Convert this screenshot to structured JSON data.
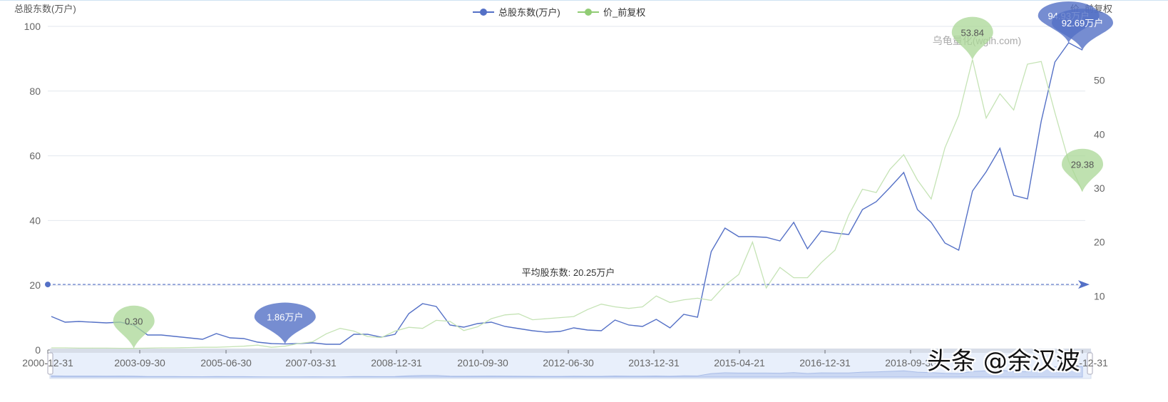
{
  "chart_data": {
    "type": "line",
    "legend": [
      "总股东数(万户)",
      "价_前复权"
    ],
    "legend_position": "top-center",
    "y_left": {
      "label": "总股东数(万户)",
      "range": [
        0,
        100
      ],
      "ticks": [
        "0",
        "20",
        "40",
        "60",
        "80",
        "100"
      ]
    },
    "y_right": {
      "label": "价_前复权",
      "range": [
        0,
        60
      ],
      "ticks": [
        "10",
        "20",
        "30",
        "40",
        "50"
      ]
    },
    "x_ticks": [
      "2000-12-31",
      "2003-09-30",
      "2005-06-30",
      "2007-03-31",
      "2008-12-31",
      "2010-09-30",
      "2012-06-30",
      "2013-12-31",
      "2015-04-21",
      "2016-12-31",
      "2018-09-30",
      "2021-12-31"
    ],
    "series": [
      {
        "name": "总股东数(万户)",
        "color": "#5470c6",
        "axis": "left",
        "values": [
          10.35,
          8.59,
          8.81,
          8.59,
          8.37,
          8.59,
          7.71,
          4.63,
          4.63,
          4.19,
          3.74,
          3.3,
          5.07,
          3.74,
          3.52,
          2.42,
          1.98,
          1.86,
          1.98,
          2.2,
          1.76,
          1.76,
          4.85,
          4.85,
          3.96,
          4.85,
          11.23,
          14.32,
          13.44,
          7.71,
          7.05,
          8.15,
          8.59,
          7.27,
          6.61,
          5.95,
          5.51,
          5.73,
          6.83,
          6.17,
          5.95,
          9.25,
          7.71,
          7.27,
          9.47,
          6.83,
          11.01,
          10.13,
          30.4,
          37.67,
          35.02,
          35.02,
          34.8,
          33.7,
          39.43,
          31.28,
          36.78,
          36.12,
          35.68,
          43.39,
          45.81,
          50.22,
          54.85,
          43.39,
          39.43,
          33.04,
          30.84,
          49.12,
          55.07,
          62.33,
          47.8,
          46.7,
          70.7,
          88.99,
          94.93,
          92.69
        ]
      },
      {
        "name": "价_前复权",
        "color": "#91cc75",
        "axis": "right",
        "values": [
          0.4,
          0.4,
          0.35,
          0.35,
          0.35,
          0.32,
          0.3,
          0.35,
          0.4,
          0.4,
          0.45,
          0.5,
          0.5,
          0.6,
          0.7,
          0.9,
          0.5,
          0.7,
          1.2,
          1.5,
          3,
          4,
          3.5,
          2.5,
          2.3,
          3.5,
          4.2,
          4,
          5.5,
          5.3,
          3.6,
          4.3,
          5.8,
          6.5,
          6.7,
          5.6,
          5.8,
          6,
          6.2,
          7.5,
          8.5,
          8,
          7.7,
          8,
          10,
          8.8,
          9.3,
          9.6,
          9.2,
          12,
          14,
          20,
          11.5,
          15.3,
          13.4,
          13.4,
          16.2,
          18.5,
          25,
          29.8,
          29.2,
          33.5,
          36.2,
          31.5,
          28,
          37.5,
          43.5,
          53.84,
          43,
          47.5,
          44.5,
          53,
          53.5,
          44,
          35,
          29.38
        ]
      }
    ],
    "pins": [
      {
        "series": 0,
        "label": "1.86万户"
      },
      {
        "series": 0,
        "label": "94.93万户"
      },
      {
        "series": 0,
        "label": "92.69万户"
      },
      {
        "series": 1,
        "label": "0.30"
      },
      {
        "series": 1,
        "label": "53.84"
      },
      {
        "series": 1,
        "label": "29.38"
      }
    ],
    "mark_line": {
      "label": "平均股东数: 20.25万户",
      "value": 20.25
    },
    "watermark": "乌龟量化(wglh.com)"
  },
  "overlay_watermark": "头条 @余汉波"
}
